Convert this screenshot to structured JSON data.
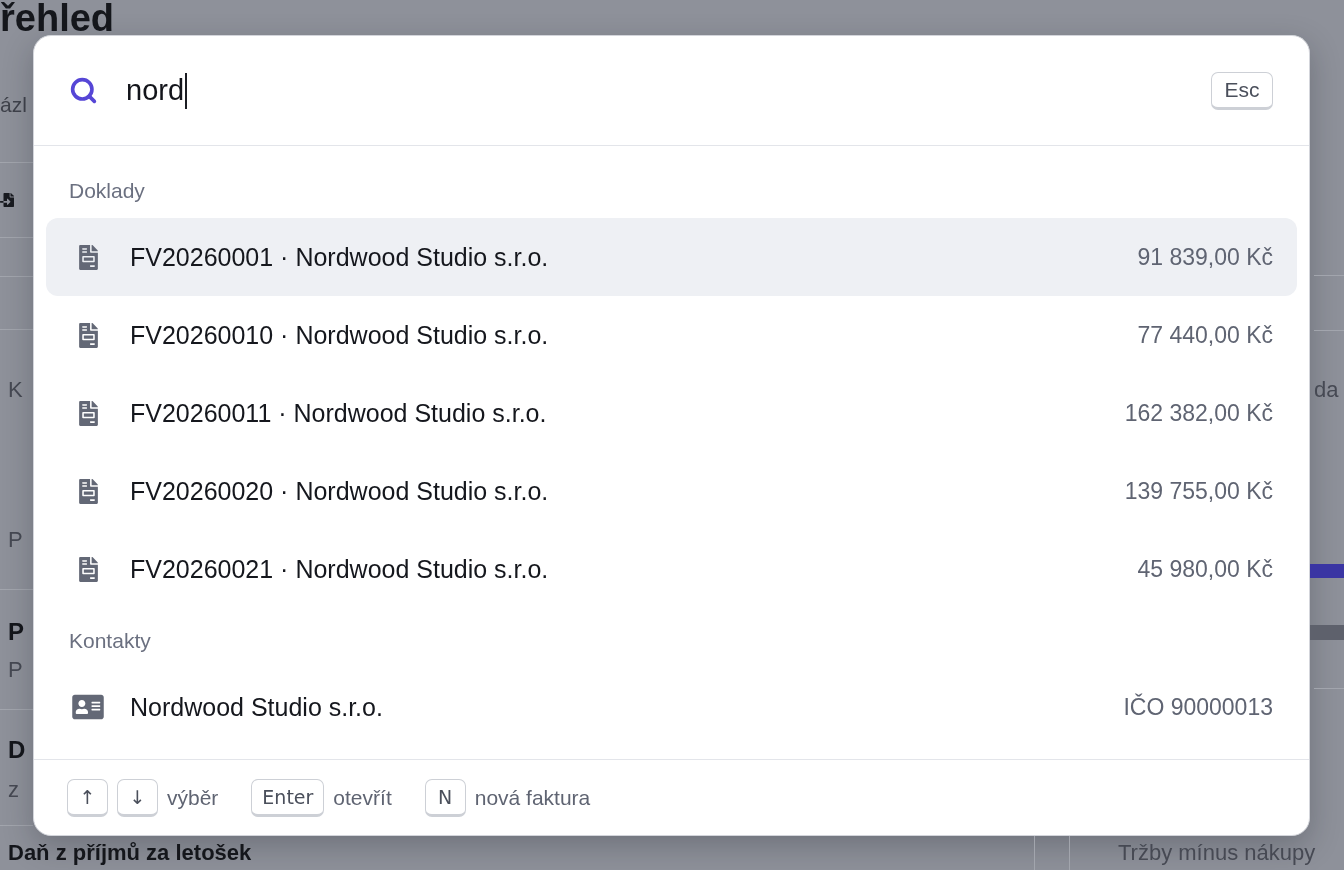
{
  "backdrop": {
    "title": "řehled",
    "subtitle": "ázl",
    "left_card": {
      "label": "K",
      "note": "P"
    },
    "left_list": [
      {
        "title": "P",
        "subtitle": "P"
      },
      {
        "title": "D",
        "subtitle": "z"
      }
    ],
    "bottom_heading": "Daň z příjmů za letošek",
    "right_card": {
      "label": "da"
    },
    "right_caption": "Tržby mínus nákupy"
  },
  "palette": {
    "search": {
      "value": "nord"
    },
    "close_key": "Esc",
    "sections": [
      {
        "title": "Doklady",
        "items": [
          {
            "kind": "document",
            "title": "FV20260001 · Nordwood Studio s.r.o.",
            "meta": "91 839,00 Kč",
            "selected": true
          },
          {
            "kind": "document",
            "title": "FV20260010 · Nordwood Studio s.r.o.",
            "meta": "77 440,00 Kč",
            "selected": false
          },
          {
            "kind": "document",
            "title": "FV20260011 · Nordwood Studio s.r.o.",
            "meta": "162 382,00 Kč",
            "selected": false
          },
          {
            "kind": "document",
            "title": "FV20260020 · Nordwood Studio s.r.o.",
            "meta": "139 755,00 Kč",
            "selected": false
          },
          {
            "kind": "document",
            "title": "FV20260021 · Nordwood Studio s.r.o.",
            "meta": "45 980,00 Kč",
            "selected": false
          }
        ]
      },
      {
        "title": "Kontakty",
        "items": [
          {
            "kind": "contact",
            "title": "Nordwood Studio s.r.o.",
            "meta": "IČO 90000013",
            "selected": false
          }
        ]
      }
    ],
    "hints": [
      {
        "keys": [
          "↑",
          "↓"
        ],
        "label": "výběr"
      },
      {
        "keys": [
          "Enter"
        ],
        "label": "otevřít"
      },
      {
        "keys": [
          "N"
        ],
        "label": "nová faktura"
      }
    ]
  }
}
